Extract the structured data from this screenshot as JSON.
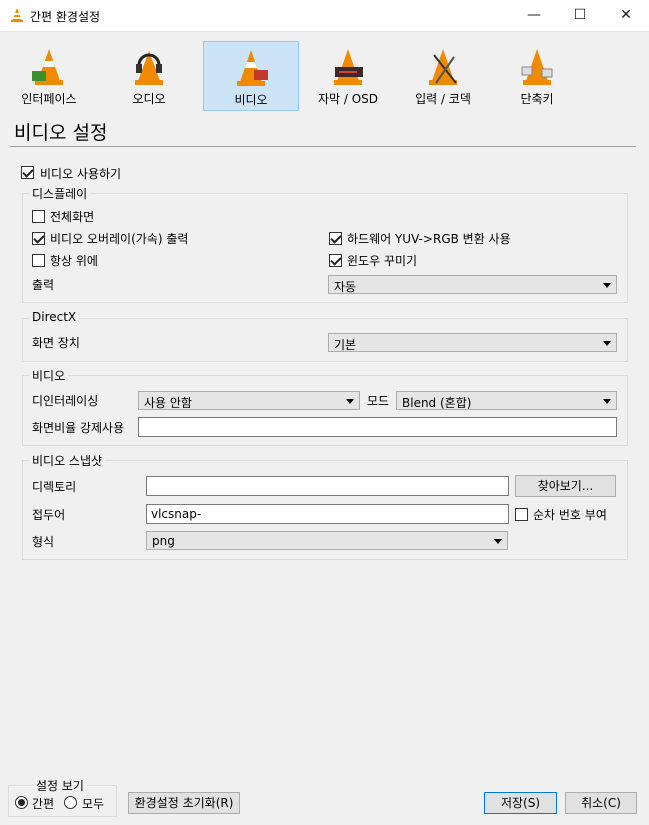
{
  "window": {
    "title": "간편 환경설정",
    "minimize": "—",
    "maximize": "☐",
    "close": "✕"
  },
  "categories": [
    {
      "label": "인터페이스",
      "icon": "interface-cone-icon",
      "selected": false
    },
    {
      "label": "오디오",
      "icon": "audio-headphones-cone-icon",
      "selected": false
    },
    {
      "label": "비디오",
      "icon": "video-cone-icon",
      "selected": true
    },
    {
      "label": "자막 / OSD",
      "icon": "subtitles-cone-icon",
      "selected": false
    },
    {
      "label": "입력 / 코덱",
      "icon": "input-codecs-cone-icon",
      "selected": false
    },
    {
      "label": "단축키",
      "icon": "hotkeys-cone-icon",
      "selected": false
    }
  ],
  "page_title": "비디오 설정",
  "enable_video": {
    "label": "비디오 사용하기",
    "checked": true
  },
  "display": {
    "group_label": "디스플레이",
    "fullscreen": {
      "label": "전체화면",
      "checked": false
    },
    "overlay": {
      "label": "비디오 오버레이(가속) 출력",
      "checked": true
    },
    "hw_yuv": {
      "label": "하드웨어 YUV->RGB 변환 사용",
      "checked": true
    },
    "always_on_top": {
      "label": "항상 위에",
      "checked": false
    },
    "decorations": {
      "label": "윈도우 꾸미기",
      "checked": true
    },
    "output_label": "출력",
    "output_value": "자동"
  },
  "directx": {
    "group_label": "DirectX",
    "device_label": "화면 장치",
    "device_value": "기본"
  },
  "video": {
    "group_label": "비디오",
    "deinterlace_label": "디인터레이싱",
    "deinterlace_value": "사용 안함",
    "mode_label": "모드",
    "mode_value": "Blend (혼합)",
    "aspect_label": "화면비율 강제사용",
    "aspect_value": ""
  },
  "snapshot": {
    "group_label": "비디오 스냅샷",
    "directory_label": "디렉토리",
    "directory_value": "",
    "browse_button": "찾아보기...",
    "prefix_label": "접두어",
    "prefix_value": "vlcsnap-",
    "sequential": {
      "label": "순차 번호 부여",
      "checked": false
    },
    "format_label": "형식",
    "format_value": "png"
  },
  "show_settings": {
    "group_label": "설정 보기",
    "simple": {
      "label": "간편",
      "checked": true
    },
    "all": {
      "label": "모두",
      "checked": false
    }
  },
  "buttons": {
    "reset": "환경설정 초기화(R)",
    "save": "저장(S)",
    "cancel": "취소(C)"
  },
  "colors": {
    "accent": "#0078d7",
    "selected_bg": "#cce4f7",
    "cone_orange": "#f08a00"
  }
}
